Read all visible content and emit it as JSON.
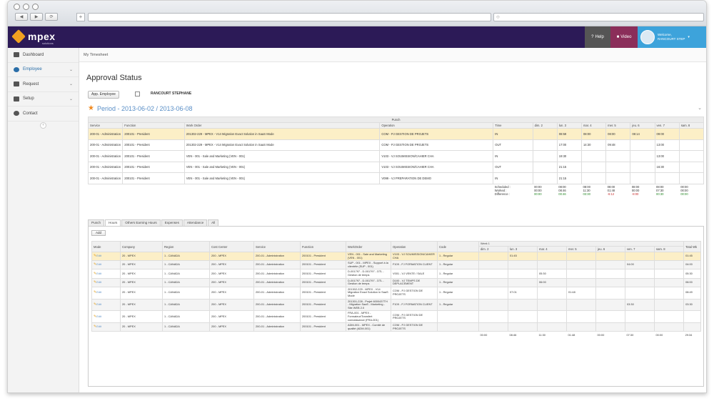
{
  "browser": {
    "nav": [
      "◀",
      "▶",
      "⟳"
    ],
    "new_tab": "+"
  },
  "brand": {
    "name": "mpex",
    "tagline": "solutions"
  },
  "topbar": {
    "help": "Help",
    "video": "Video",
    "welcome": "Welcome,",
    "user": "RANCOURT STEP"
  },
  "sidebar": {
    "items": [
      {
        "label": "Dashboard",
        "icon": "dashboard-icon",
        "chev": ""
      },
      {
        "label": "Employee",
        "icon": "employee-icon",
        "chev": "⌄"
      },
      {
        "label": "Request",
        "icon": "request-icon",
        "chev": "⌄"
      },
      {
        "label": "Setup",
        "icon": "setup-icon",
        "chev": "⌄"
      },
      {
        "label": "Contact",
        "icon": "contact-icon",
        "chev": ""
      }
    ],
    "collapse": "‹"
  },
  "breadcrumb": "My Timesheet",
  "title": "Approval Status",
  "employee_button": "App. Employee",
  "employee_name": "RANCOURT STEPHANE",
  "period": "Period - 2013-06-02 / 2013-06-08",
  "punch": {
    "band": "Punch",
    "headers": [
      "Service",
      "Function",
      "Work Order",
      "Operation",
      "Time",
      "dim. 2",
      "lun. 3",
      "mar. 4",
      "mer. 5",
      "jeu. 6",
      "ven. 7",
      "sam. 8"
    ],
    "rows": [
      [
        "200-01 - Administration",
        "200101 - President",
        "201302-229 - MPEX - V14 Migration Exact Solution in SaaS Mode",
        "COM - PJ GESTION DE PROJETS",
        "IN",
        "",
        "08:59",
        "08:00",
        "08:00",
        "08:14",
        "09:00",
        ""
      ],
      [
        "200-01 - Administration",
        "200101 - President",
        "201302-229 - MPEX - V14 Migration Exact Solution in SaaS Mode",
        "COM - PJ GESTION DE PROJETS",
        "OUT",
        "",
        "17:00",
        "14:30",
        "09:48",
        "",
        "13:00",
        ""
      ],
      [
        "200-01 - Administration",
        "200101 - President",
        "VEN - 001 - Sale and Marketing (VEN - 001)",
        "V103 - VJ SOUMISSION/CAHIER CHA",
        "IN",
        "",
        "19:30",
        "",
        "",
        "",
        "13:00",
        ""
      ],
      [
        "200-01 - Administration",
        "200101 - President",
        "VEN - 001 - Sale and Marketing (VEN - 001)",
        "V103 - VJ SOUMISSION/CAHIER CHA",
        "OUT",
        "",
        "21:15",
        "",
        "",
        "",
        "16:30",
        ""
      ],
      [
        "200-01 - Administration",
        "200101 - President",
        "VEN - 001 - Sale and Marketing (VEN - 001)",
        "V099 - VJ PREPARATION DE DEMO",
        "IN",
        "",
        "21:15",
        "",
        "",
        "",
        "",
        ""
      ]
    ],
    "totals_label": "Scheduled :\nWorked :\nDifference :",
    "totals": [
      [
        "00:00",
        "00:00",
        "00:00"
      ],
      [
        "08:00",
        "08:46",
        "00:46"
      ],
      [
        "08:00",
        "11:30",
        "03:30"
      ],
      [
        "08:00",
        "01:48",
        "-6:12"
      ],
      [
        "08:00",
        "00:00",
        "-8:00"
      ],
      [
        "08:00",
        "07:30",
        "00:30"
      ],
      [
        "00:00",
        "00:00",
        "00:00"
      ]
    ]
  },
  "tabs": [
    "Punch",
    "Hours",
    "Others Earning Hours",
    "Expenses",
    "Attendance",
    "All"
  ],
  "hours": {
    "add": "Add",
    "headers": [
      "Mode",
      "Company",
      "Region",
      "Cost Center",
      "Service",
      "Function",
      "WorkOrder",
      "Operation",
      "Code",
      "Week 1",
      "Total Wk"
    ],
    "days": [
      "dim. 2",
      "lun. 3",
      "mar. 4",
      "mer. 5",
      "jeu. 6",
      "ven. 7",
      "sam. 8"
    ],
    "rows": [
      {
        "mode": "Edit",
        "company": "20 - MPEX",
        "region": "1 - CANADA",
        "cc": "200 - MPEX",
        "service": "200-01 - Administration",
        "function": "200101 - President",
        "wo": "VEN - 001 - Sale and Marketing (VEN - 001)",
        "op": "V103 - VJ SOUMISSION/CAHIER CHA",
        "code": "1 - Regular",
        "d": [
          "",
          "01:45",
          "",
          "",
          "",
          "",
          ""
        ],
        "total": "01:45"
      },
      {
        "mode": "Edit",
        "company": "20 - MPEX",
        "region": "1 - CANADA",
        "cc": "200 - MPEX",
        "service": "200-01 - Administration",
        "function": "200101 - President",
        "wo": "SUP - 001 - MPEX - Support à la clientèle (SUP - 001)",
        "op": "F109 - FJ FORMATION CLIENT",
        "code": "1 - Regular",
        "d": [
          "",
          "",
          "",
          "",
          "",
          "04:00",
          ""
        ],
        "total": "04:00"
      },
      {
        "mode": "Edit",
        "company": "20 - MPEX",
        "region": "1 - CANADA",
        "cc": "200 - MPEX",
        "service": "200-01 - Administration",
        "function": "200101 - President",
        "wo": "D-001797 - D-001797 - DTL - Gestion de temps",
        "op": "V001 - VJ VENTE / SALE",
        "code": "1 - Regular",
        "d": [
          "",
          "",
          "05:30",
          "",
          "",
          "",
          ""
        ],
        "total": "05:30"
      },
      {
        "mode": "Edit",
        "company": "20 - MPEX",
        "region": "1 - CANADA",
        "cc": "200 - MPEX",
        "service": "200-01 - Administration",
        "function": "200101 - President",
        "wo": "D-001797 - D-001797 - DTL - Gestion de temps",
        "op": "D100 - VJ TEMPS DE DEPLACEMENT",
        "code": "1 - Regular",
        "d": [
          "",
          "",
          "06:00",
          "",
          "",
          "",
          ""
        ],
        "total": "06:00"
      },
      {
        "mode": "Edit",
        "company": "20 - MPEX",
        "region": "1 - CANADA",
        "cc": "200 - MPEX",
        "service": "200-01 - Administration",
        "function": "200101 - President",
        "wo": "201302-229 - MPEX - V14 Migration Exact Solution in SaaS Mode",
        "op": "COM - PJ GESTION DE PROJETS",
        "code": "1 - Regular",
        "d": [
          "",
          "07:01",
          "",
          "01:48",
          "",
          "",
          ""
        ],
        "total": "08:49"
      },
      {
        "mode": "Edit",
        "company": "20 - MPEX",
        "region": "1 - CANADA",
        "cc": "200 - MPEX",
        "service": "200-01 - Administration",
        "function": "200101 - President",
        "wo": "201301-228 - Projet 6000437TH - Migration SaaS - Marketing - Site WEB 2.0",
        "op": "F109 - FJ FORMATION CLIENT",
        "code": "1 - Regular",
        "d": [
          "",
          "",
          "",
          "",
          "",
          "03:30",
          ""
        ],
        "total": "03:30"
      },
      {
        "mode": "Edit",
        "company": "20 - MPEX",
        "region": "1 - CANADA",
        "cc": "200 - MPEX",
        "service": "200-01 - Administration",
        "function": "200101 - President",
        "wo": "FRA-001 - MPEX - Formateur/Transfert connaissance (FRA-001)",
        "op": "COM - PJ GESTION DE PROJETS",
        "code": "",
        "d": [
          "",
          "",
          "",
          "",
          "",
          "",
          ""
        ],
        "total": ""
      },
      {
        "mode": "Edit",
        "company": "20 - MPEX",
        "region": "1 - CANADA",
        "cc": "200 - MPEX",
        "service": "200-01 - Administration",
        "function": "200101 - President",
        "wo": "ADM-001 - MPEX - Comité de qualité (ADM-001)",
        "op": "COM - PJ GESTION DE PROJETS",
        "code": "",
        "d": [
          "",
          "",
          "",
          "",
          "",
          "",
          ""
        ],
        "total": ""
      }
    ],
    "totals": [
      "00:00",
      "08:46",
      "11:30",
      "01:48",
      "00:00",
      "07:30",
      "00:00",
      "29:34"
    ]
  }
}
